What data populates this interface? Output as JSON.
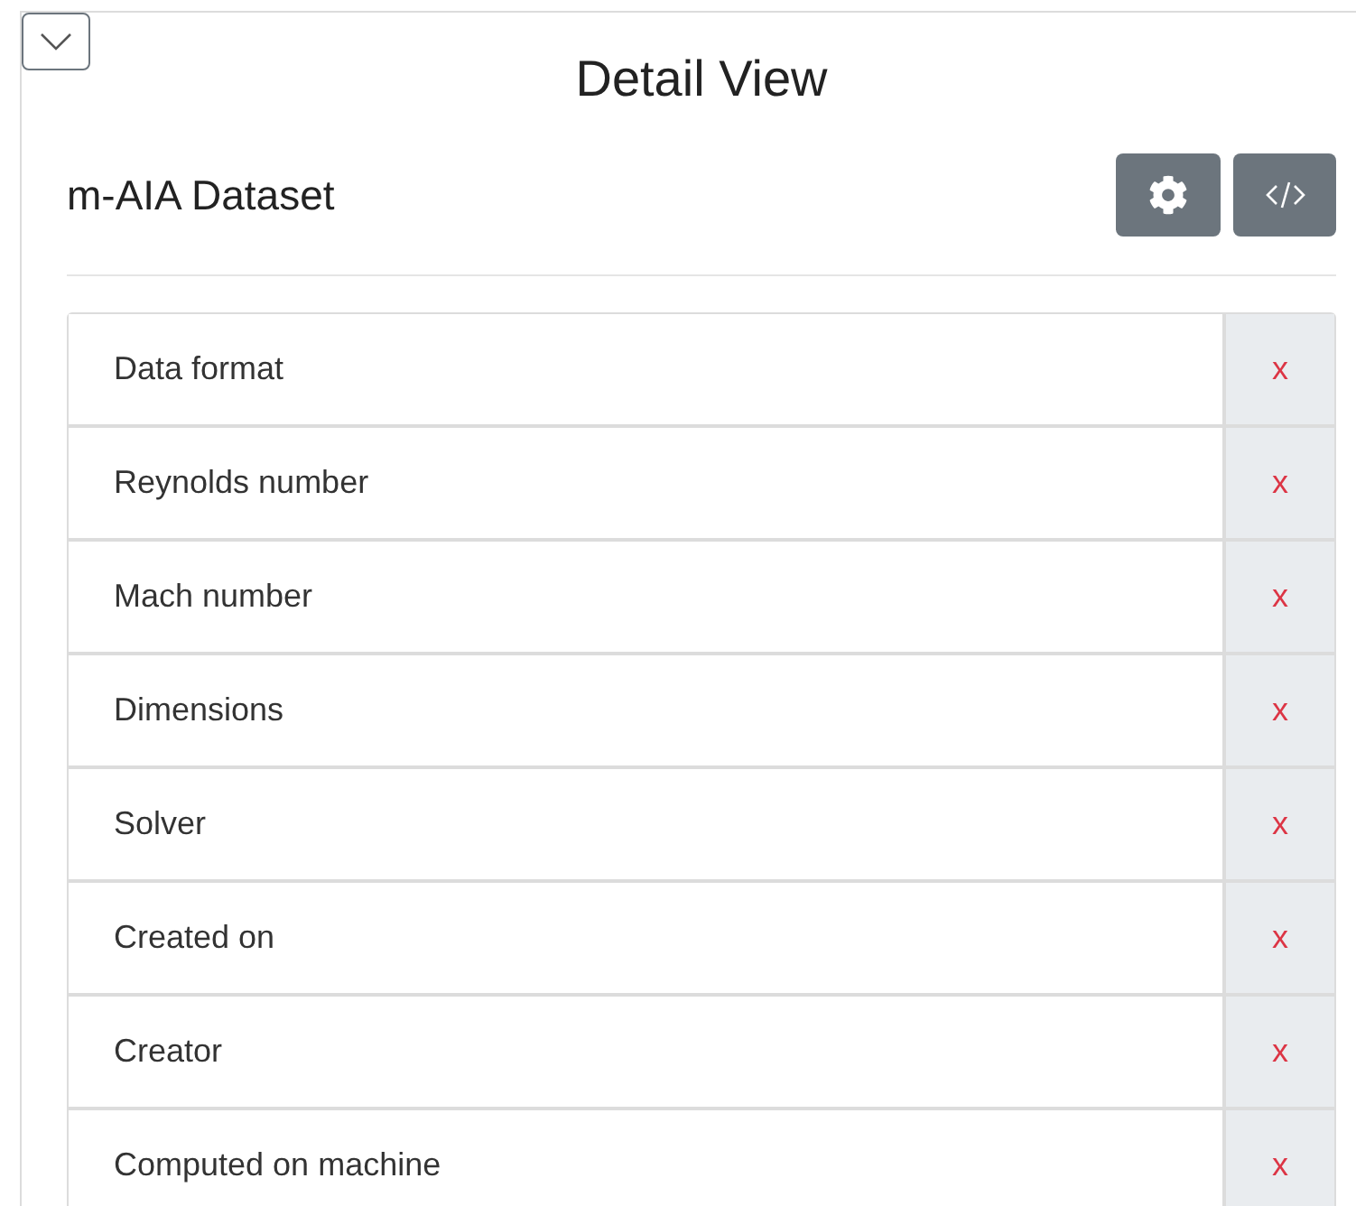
{
  "title": "Detail View",
  "dataset": {
    "name": "m-AIA Dataset"
  },
  "fields": [
    {
      "label": "Data format",
      "remove": "x"
    },
    {
      "label": "Reynolds number",
      "remove": "x"
    },
    {
      "label": "Mach number",
      "remove": "x"
    },
    {
      "label": "Dimensions",
      "remove": "x"
    },
    {
      "label": "Solver",
      "remove": "x"
    },
    {
      "label": "Created on",
      "remove": "x"
    },
    {
      "label": "Creator",
      "remove": "x"
    },
    {
      "label": "Computed on machine",
      "remove": "x"
    }
  ]
}
